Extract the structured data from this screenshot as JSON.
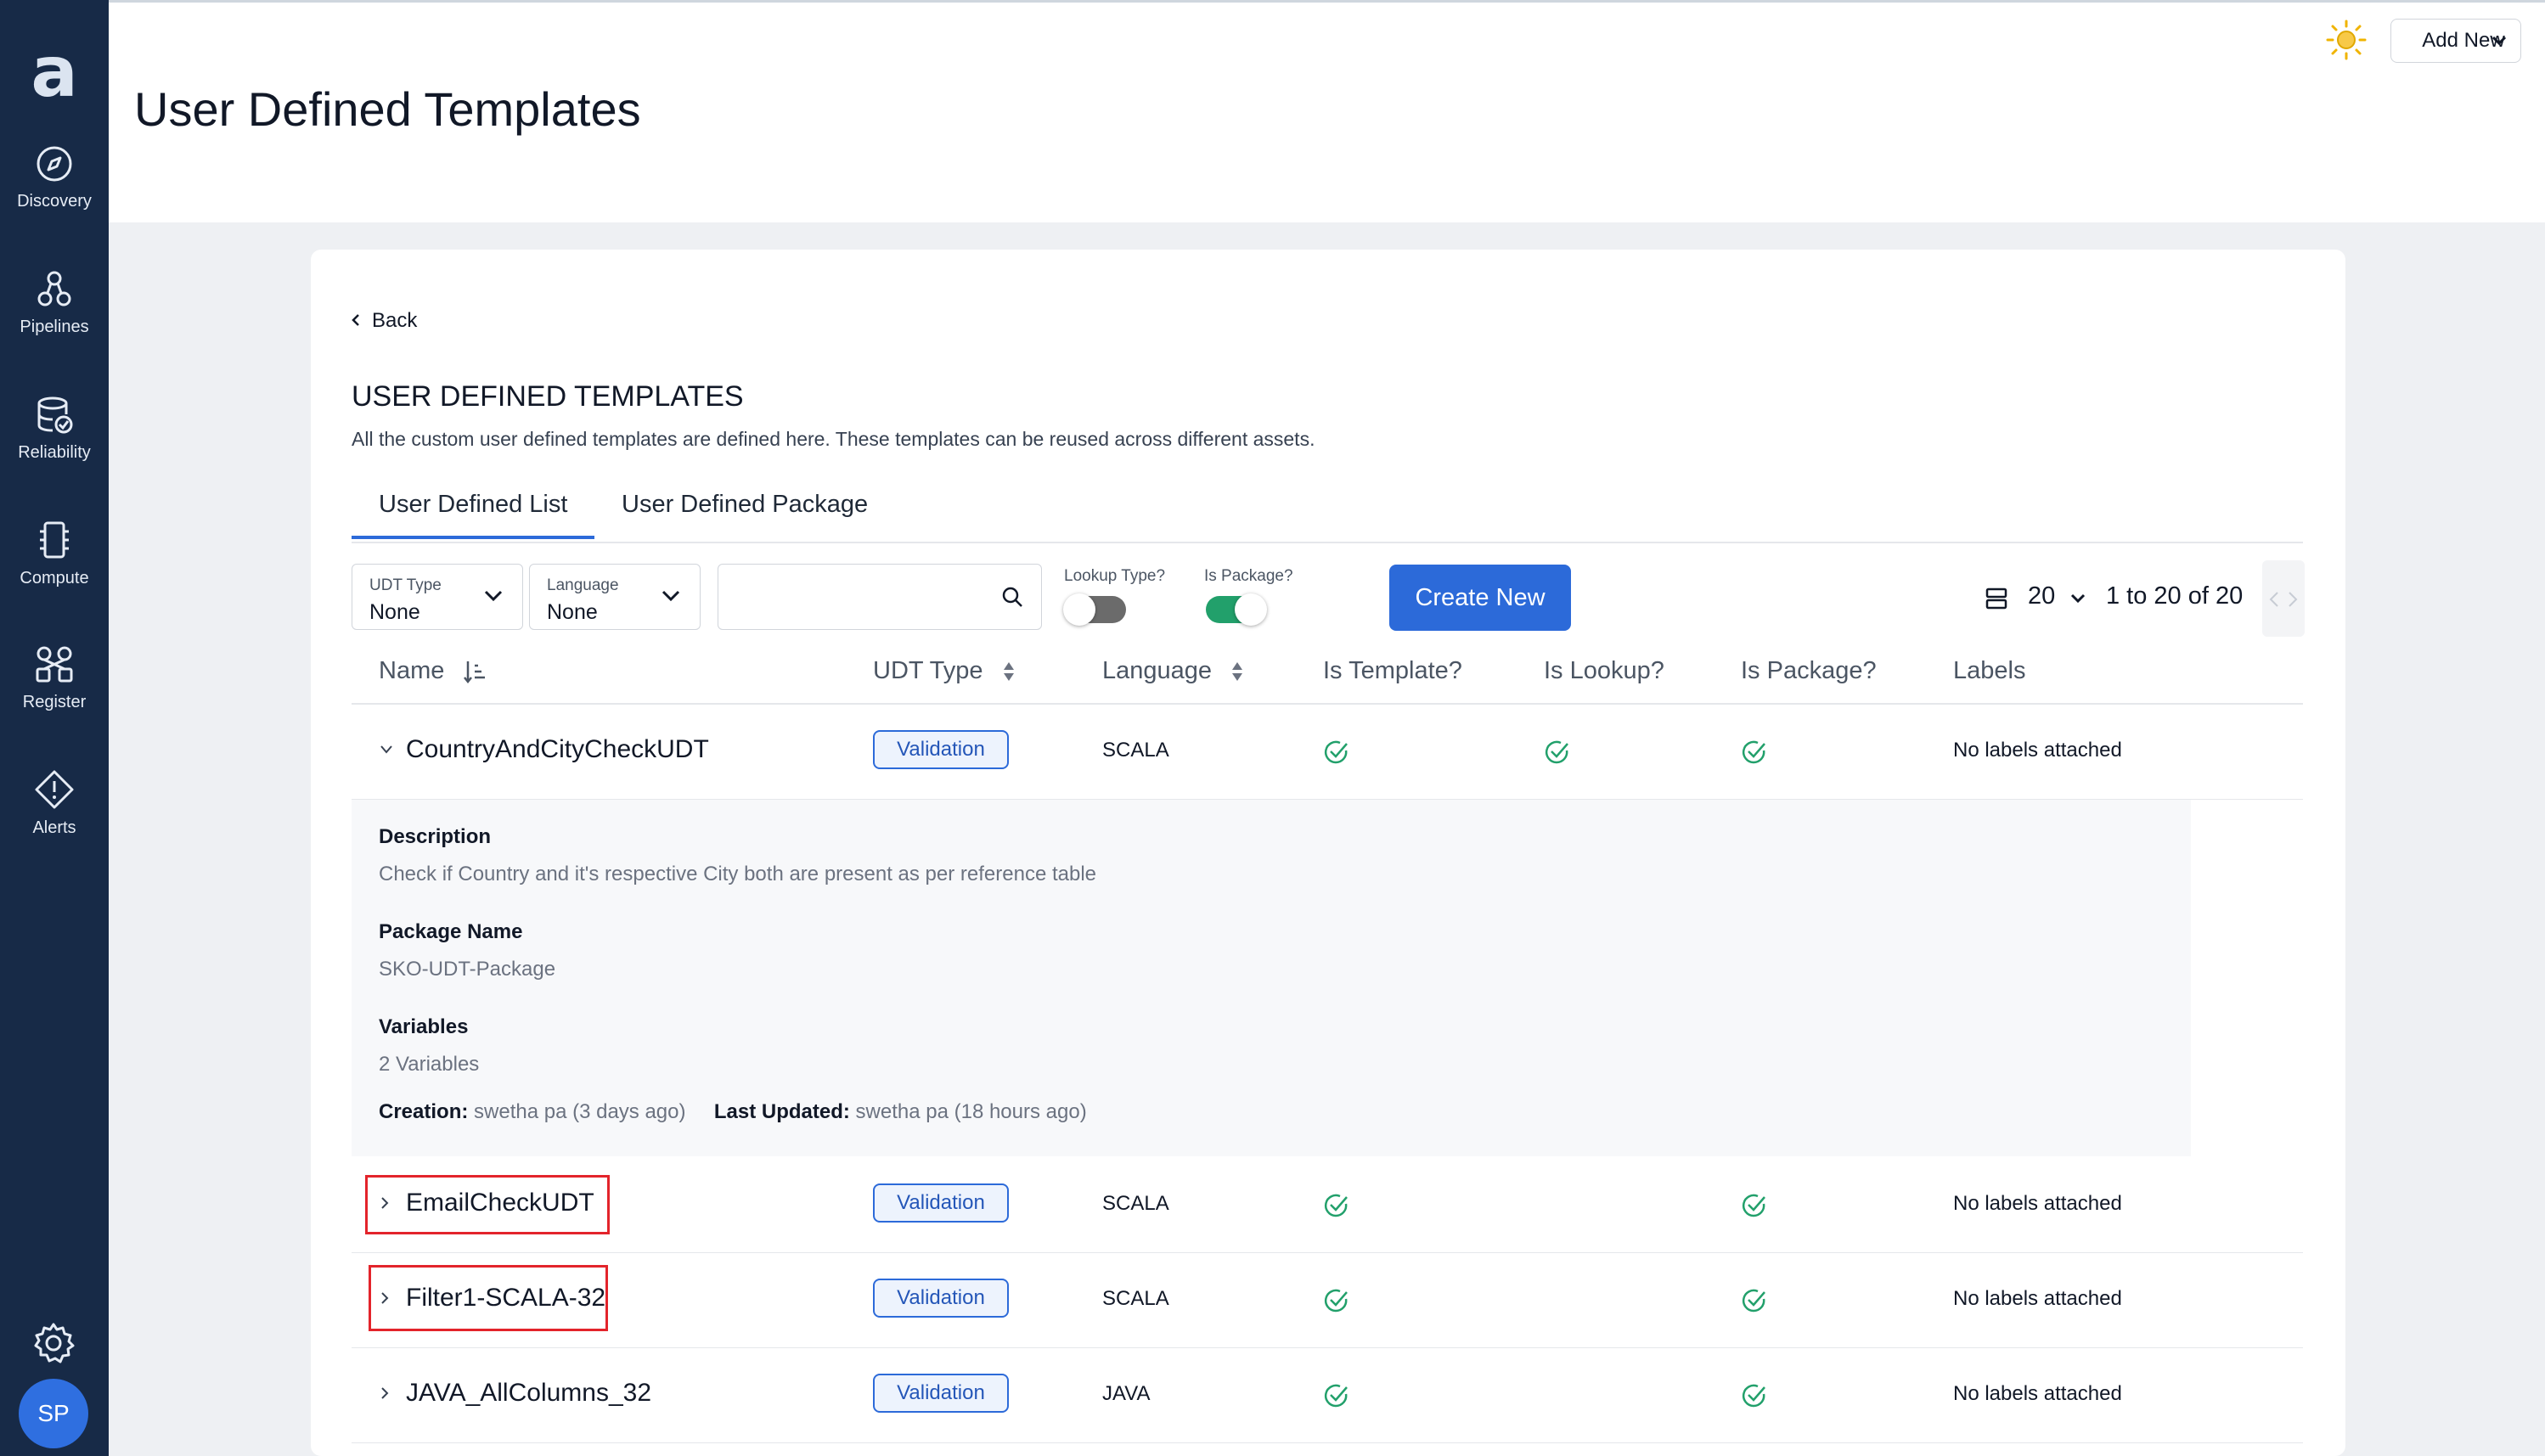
{
  "app": {
    "logo": "a",
    "page_title": "User Defined Templates"
  },
  "sidebar": {
    "items": [
      {
        "label": "Discovery",
        "icon": "compass-icon"
      },
      {
        "label": "Pipelines",
        "icon": "pipelines-icon"
      },
      {
        "label": "Reliability",
        "icon": "database-check-icon"
      },
      {
        "label": "Compute",
        "icon": "chip-icon"
      },
      {
        "label": "Register",
        "icon": "register-icon"
      },
      {
        "label": "Alerts",
        "icon": "alert-diamond-icon"
      }
    ],
    "settings_icon": "gear-icon",
    "avatar_initials": "SP"
  },
  "header": {
    "theme_icon": "sun-icon",
    "add_new_label": "Add New"
  },
  "content": {
    "back_label": "Back",
    "section_title": "USER DEFINED TEMPLATES",
    "section_description": "All the custom user defined templates are defined here. These templates can be reused across different assets.",
    "tabs": [
      {
        "label": "User Defined List",
        "active": true
      },
      {
        "label": "User Defined Package",
        "active": false
      }
    ]
  },
  "filters": {
    "udt_type": {
      "label": "UDT Type",
      "value": "None"
    },
    "language": {
      "label": "Language",
      "value": "None"
    },
    "search": {
      "placeholder": "",
      "value": ""
    },
    "lookup_type": {
      "label": "Lookup Type?",
      "on": false
    },
    "is_package": {
      "label": "Is Package?",
      "on": true
    },
    "create_label": "Create New",
    "page_size": "20",
    "page_range": "1 to 20 of 20"
  },
  "table": {
    "columns": [
      "Name",
      "UDT Type",
      "Language",
      "Is Template?",
      "Is Lookup?",
      "Is Package?",
      "Labels"
    ],
    "rows": [
      {
        "name": "CountryAndCityCheckUDT",
        "udt_type": "Validation",
        "language": "SCALA",
        "is_template": true,
        "is_lookup": true,
        "is_package": true,
        "labels": "No labels attached",
        "expanded": true
      },
      {
        "name": "EmailCheckUDT",
        "udt_type": "Validation",
        "language": "SCALA",
        "is_template": true,
        "is_lookup": false,
        "is_package": true,
        "labels": "No labels attached",
        "expanded": false
      },
      {
        "name": "Filter1-SCALA-32",
        "udt_type": "Validation",
        "language": "SCALA",
        "is_template": true,
        "is_lookup": false,
        "is_package": true,
        "labels": "No labels attached",
        "expanded": false
      },
      {
        "name": "JAVA_AllColumns_32",
        "udt_type": "Validation",
        "language": "JAVA",
        "is_template": true,
        "is_lookup": false,
        "is_package": true,
        "labels": "No labels attached",
        "expanded": false
      }
    ],
    "details": {
      "description_label": "Description",
      "description": "Check if Country and it's respective City both are present as per reference table",
      "package_label": "Package Name",
      "package": "SKO-UDT-Package",
      "variables_label": "Variables",
      "variables": "2 Variables",
      "creation_label": "Creation:",
      "creation": "swetha pa (3 days ago)",
      "updated_label": "Last Updated:",
      "updated": "swetha pa (18 hours ago)"
    }
  },
  "colors": {
    "sidebar": "#172a47",
    "accent": "#2c6ad9",
    "success": "#22a06b",
    "highlight": "#e3242b"
  }
}
